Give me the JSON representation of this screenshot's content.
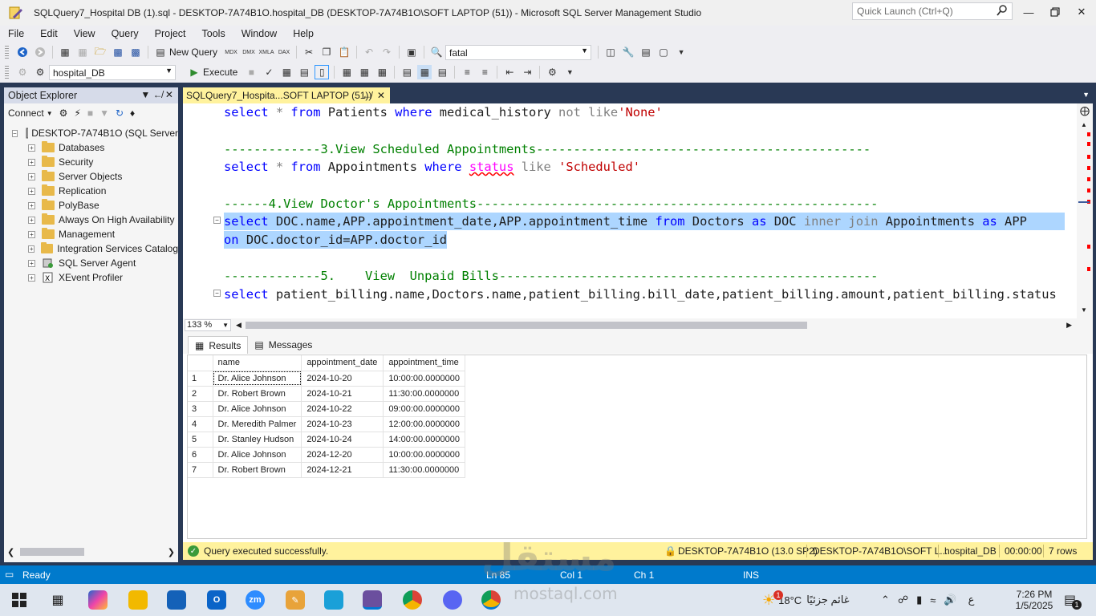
{
  "window": {
    "title": "SQLQuery7_Hospital DB (1).sql - DESKTOP-7A74B1O.hospital_DB (DESKTOP-7A74B1O\\SOFT LAPTOP (51)) - Microsoft SQL Server Management Studio",
    "quick_launch_placeholder": "Quick Launch (Ctrl+Q)"
  },
  "menu": [
    "File",
    "Edit",
    "View",
    "Query",
    "Project",
    "Tools",
    "Window",
    "Help"
  ],
  "toolbar": {
    "new_query": "New Query",
    "search_combo": "fatal",
    "database_combo": "hospital_DB",
    "execute": "Execute"
  },
  "object_explorer": {
    "title": "Object Explorer",
    "connect": "Connect",
    "server": "DESKTOP-7A74B1O (SQL Server",
    "nodes": [
      "Databases",
      "Security",
      "Server Objects",
      "Replication",
      "PolyBase",
      "Always On High Availability",
      "Management",
      "Integration Services Catalog",
      "SQL Server Agent",
      "XEvent Profiler"
    ]
  },
  "editor": {
    "tab_title": "SQLQuery7_Hospita...SOFT LAPTOP (51))",
    "zoom": "133 %",
    "lines": {
      "l1_a": "select",
      "l1_b": " * ",
      "l1_c": "from",
      "l1_d": " Patients ",
      "l1_e": "where",
      "l1_f": " medical_history ",
      "l1_g": "not like",
      "l1_h": "'None'",
      "l3": "-------------3.View Scheduled Appointments---------------------------------------------",
      "l4_a": "select",
      "l4_b": " * ",
      "l4_c": "from",
      "l4_d": " Appointments ",
      "l4_e": "where",
      "l4_f": "status",
      "l4_g": " like ",
      "l4_h": "'Scheduled'",
      "l6": "------4.View Doctor's Appointments------------------------------------------------------",
      "l7_a": "select",
      "l7_b": " DOC.name,APP.appointment_date,APP.appointment_time ",
      "l7_c": "from",
      "l7_d": " Doctors ",
      "l7_e": "as",
      "l7_f": " DOC ",
      "l7_g": "inner join",
      "l7_h": " Appointments ",
      "l7_i": "as",
      "l7_j": " APP",
      "l8_a": "on",
      "l8_b": " DOC.doctor_id=APP.doctor_id",
      "l10": "-------------5.    View  Unpaid Bills---------------------------------------------------",
      "l11_a": "select",
      "l11_b": " patient_billing.name,Doctors.name,patient_billing.bill_date,patient_billing.amount,patient_billing.status"
    }
  },
  "results": {
    "tabs": [
      "Results",
      "Messages"
    ],
    "columns": [
      "name",
      "appointment_date",
      "appointment_time"
    ],
    "rows": [
      [
        "1",
        "Dr. Alice Johnson",
        "2024-10-20",
        "10:00:00.0000000"
      ],
      [
        "2",
        "Dr. Robert Brown",
        "2024-10-21",
        "11:30:00.0000000"
      ],
      [
        "3",
        "Dr. Alice Johnson",
        "2024-10-22",
        "09:00:00.0000000"
      ],
      [
        "4",
        "Dr. Meredith Palmer",
        "2024-10-23",
        "12:00:00.0000000"
      ],
      [
        "5",
        "Dr. Stanley Hudson",
        "2024-10-24",
        "14:00:00.0000000"
      ],
      [
        "6",
        "Dr. Alice Johnson",
        "2024-12-20",
        "10:00:00.0000000"
      ],
      [
        "7",
        "Dr. Robert Brown",
        "2024-12-21",
        "11:30:00.0000000"
      ]
    ]
  },
  "query_status": {
    "message": "Query executed successfully.",
    "server": "DESKTOP-7A74B1O (13.0 SP2)",
    "user": "DESKTOP-7A74B1O\\SOFT L...",
    "database": "hospital_DB",
    "elapsed": "00:00:00",
    "rows": "7 rows"
  },
  "statusbar": {
    "ready": "Ready",
    "ln": "Ln 85",
    "col": "Col 1",
    "ch": "Ch 1",
    "ins": "INS"
  },
  "taskbar": {
    "weather_temp": "18°C",
    "weather_text": "غائم جزئيًا",
    "lang": "ع",
    "time": "7:26 PM",
    "date": "1/5/2025",
    "notif_count": "1",
    "weather_badge": "1"
  },
  "watermark": {
    "main": "مستقل",
    "sub": "mostaql.com"
  }
}
